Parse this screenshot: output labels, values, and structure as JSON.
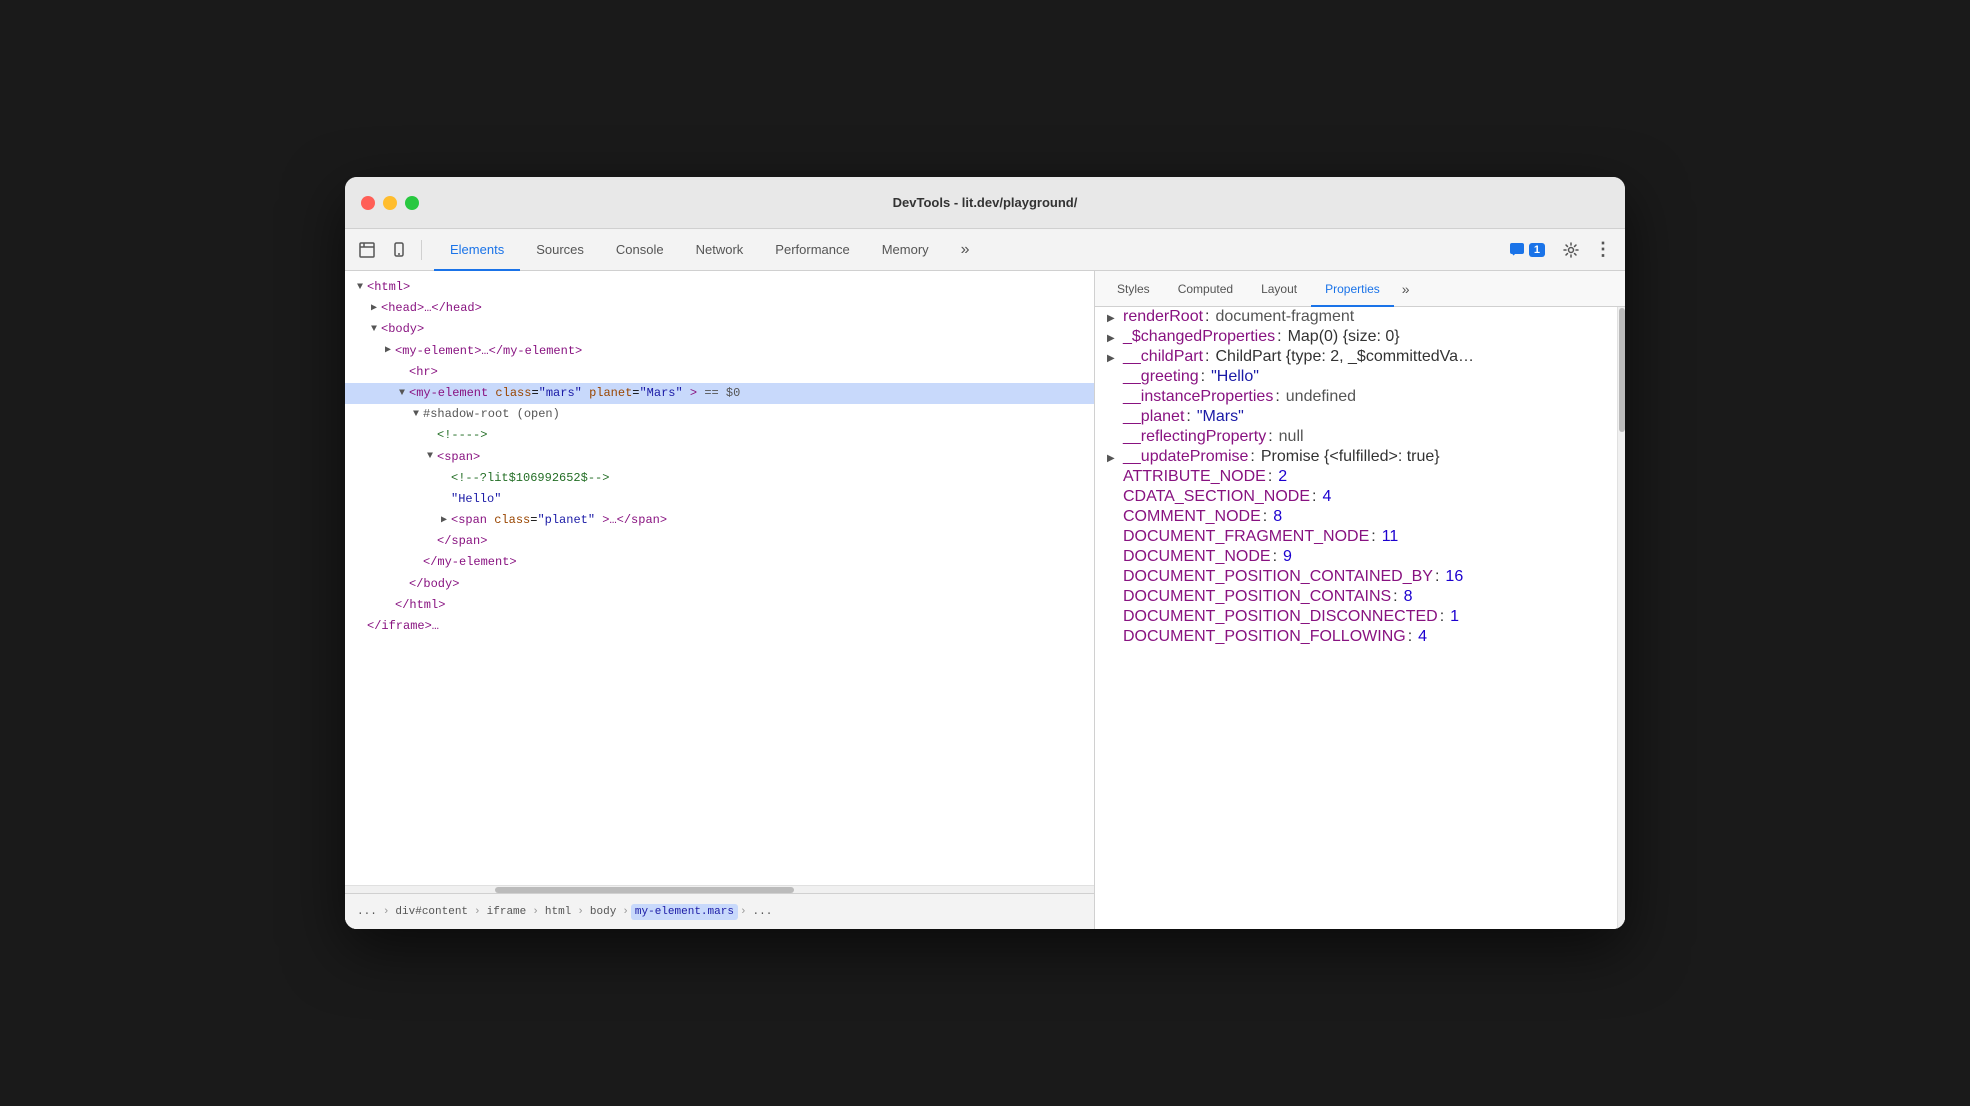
{
  "window": {
    "title": "DevTools - lit.dev/playground/"
  },
  "titlebar": {
    "title": "DevTools - lit.dev/playground/"
  },
  "tabs": {
    "main": [
      {
        "label": "Elements",
        "active": true
      },
      {
        "label": "Sources",
        "active": false
      },
      {
        "label": "Console",
        "active": false
      },
      {
        "label": "Network",
        "active": false
      },
      {
        "label": "Performance",
        "active": false
      },
      {
        "label": "Memory",
        "active": false
      }
    ],
    "right": [
      {
        "label": "Styles",
        "active": false
      },
      {
        "label": "Computed",
        "active": false
      },
      {
        "label": "Layout",
        "active": false
      },
      {
        "label": "Properties",
        "active": true
      }
    ]
  },
  "toolbar": {
    "inspector_icon": "⬜",
    "device_icon": "📱",
    "more_icon": "»",
    "chat_icon": "💬",
    "chat_count": "1",
    "settings_icon": "⚙",
    "dots_icon": "⋮"
  },
  "dom_tree": [
    {
      "indent": 0,
      "triangle": "▼",
      "content": "<html>",
      "type": "tag"
    },
    {
      "indent": 1,
      "triangle": "▶",
      "content": "<head>…</head>",
      "type": "tag"
    },
    {
      "indent": 1,
      "triangle": "▼",
      "content": "<body>",
      "type": "tag"
    },
    {
      "indent": 2,
      "triangle": "▶",
      "content": "<my-element>…</my-element>",
      "type": "tag"
    },
    {
      "indent": 3,
      "triangle": "",
      "content": "<hr>",
      "type": "tag"
    },
    {
      "indent": 3,
      "triangle": "▼",
      "content": "<my-element class=\"mars\" planet=\"Mars\"> == $0",
      "type": "selected"
    },
    {
      "indent": 4,
      "triangle": "▼",
      "content": "#shadow-root (open)",
      "type": "shadow"
    },
    {
      "indent": 5,
      "triangle": "",
      "content": "<!---->",
      "type": "comment"
    },
    {
      "indent": 5,
      "triangle": "▼",
      "content": "<span>",
      "type": "tag"
    },
    {
      "indent": 6,
      "triangle": "",
      "content": "<!--?lit$106992652$-->",
      "type": "comment"
    },
    {
      "indent": 6,
      "triangle": "",
      "content": "\"Hello\"",
      "type": "text"
    },
    {
      "indent": 6,
      "triangle": "▶",
      "content": "<span class=\"planet\">…</span>",
      "type": "tag"
    },
    {
      "indent": 5,
      "triangle": "",
      "content": "</span>",
      "type": "tag-close"
    },
    {
      "indent": 4,
      "triangle": "",
      "content": "</my-element>",
      "type": "tag-close"
    },
    {
      "indent": 3,
      "triangle": "",
      "content": "</body>",
      "type": "tag-close"
    },
    {
      "indent": 2,
      "triangle": "",
      "content": "</html>",
      "type": "tag-close"
    },
    {
      "indent": 0,
      "triangle": "",
      "content": "</iframe>…",
      "type": "tag-close"
    }
  ],
  "properties": [
    {
      "triangle": "▶",
      "key": "renderRoot",
      "colon": ":",
      "value": "document-fragment",
      "value_type": "null"
    },
    {
      "triangle": "▶",
      "key": "_$changedProperties",
      "colon": ":",
      "value": "Map(0) {size: 0}",
      "value_type": "obj"
    },
    {
      "triangle": "▶",
      "key": "__childPart",
      "colon": ":",
      "value": "ChildPart {type: 2, _$committedVa…",
      "value_type": "obj"
    },
    {
      "triangle": "",
      "key": "__greeting",
      "colon": ":",
      "value": "\"Hello\"",
      "value_type": "str"
    },
    {
      "triangle": "",
      "key": "__instanceProperties",
      "colon": ":",
      "value": "undefined",
      "value_type": "null"
    },
    {
      "triangle": "",
      "key": "__planet",
      "colon": ":",
      "value": "\"Mars\"",
      "value_type": "str"
    },
    {
      "triangle": "",
      "key": "__reflectingProperty",
      "colon": ":",
      "value": "null",
      "value_type": "null"
    },
    {
      "triangle": "▶",
      "key": "__updatePromise",
      "colon": ":",
      "value": "Promise {<fulfilled>: true}",
      "value_type": "obj"
    },
    {
      "triangle": "",
      "key": "ATTRIBUTE_NODE",
      "colon": ":",
      "value": "2",
      "value_type": "num"
    },
    {
      "triangle": "",
      "key": "CDATA_SECTION_NODE",
      "colon": ":",
      "value": "4",
      "value_type": "num"
    },
    {
      "triangle": "",
      "key": "COMMENT_NODE",
      "colon": ":",
      "value": "8",
      "value_type": "num"
    },
    {
      "triangle": "",
      "key": "DOCUMENT_FRAGMENT_NODE",
      "colon": ":",
      "value": "11",
      "value_type": "num"
    },
    {
      "triangle": "",
      "key": "DOCUMENT_NODE",
      "colon": ":",
      "value": "9",
      "value_type": "num"
    },
    {
      "triangle": "",
      "key": "DOCUMENT_POSITION_CONTAINED_BY",
      "colon": ":",
      "value": "16",
      "value_type": "num"
    },
    {
      "triangle": "",
      "key": "DOCUMENT_POSITION_CONTAINS",
      "colon": ":",
      "value": "8",
      "value_type": "num"
    },
    {
      "triangle": "",
      "key": "DOCUMENT_POSITION_DISCONNECTED",
      "colon": ":",
      "value": "1",
      "value_type": "num"
    },
    {
      "triangle": "",
      "key": "DOCUMENT_POSITION_FOLLOWING",
      "colon": ":",
      "value": "4",
      "value_type": "num"
    }
  ],
  "breadcrumb": {
    "items": [
      "...",
      "div#content",
      "iframe",
      "html",
      "body",
      "my-element.mars",
      "..."
    ]
  }
}
